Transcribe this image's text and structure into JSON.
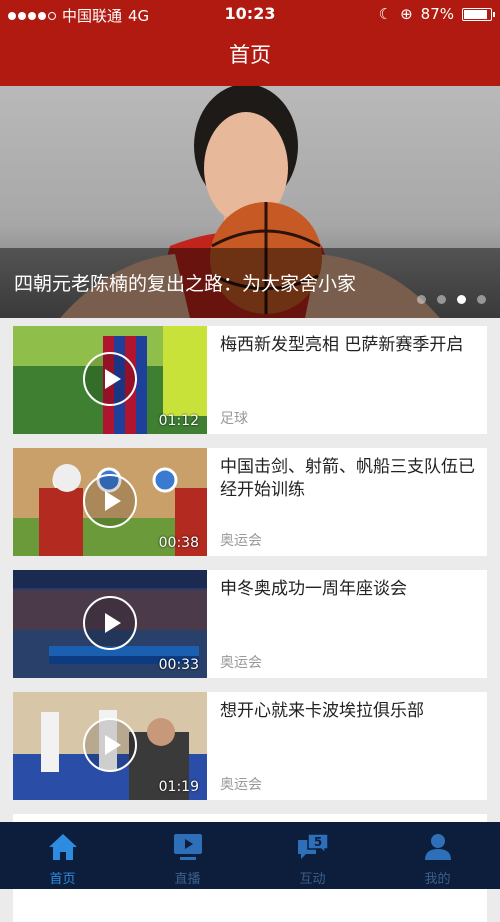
{
  "status_bar": {
    "carrier": "中国联通",
    "network": "4G",
    "time": "10:23",
    "battery": "87%",
    "battery_level": 0.87
  },
  "nav": {
    "title": "首页"
  },
  "banner": {
    "caption": "四朝元老陈楠的复出之路：为大家舍小家",
    "page_count": 4,
    "active_page": 3
  },
  "videos": [
    {
      "title": "梅西新发型亮相 巴萨新赛季开启",
      "category": "足球",
      "duration": "01:12"
    },
    {
      "title": "中国击剑、射箭、帆船三支队伍已经开始训练",
      "category": "奥运会",
      "duration": "00:38"
    },
    {
      "title": "申冬奥成功一周年座谈会",
      "category": "奥运会",
      "duration": "00:33"
    },
    {
      "title": "想开心就来卡波埃拉俱乐部",
      "category": "奥运会",
      "duration": "01:19"
    }
  ],
  "tabs": [
    {
      "label": "首页",
      "icon": "home-icon",
      "active": true
    },
    {
      "label": "直播",
      "icon": "live-tv-icon",
      "active": false
    },
    {
      "label": "互动",
      "icon": "chat-bubbles-icon",
      "badge": "5",
      "active": false
    },
    {
      "label": "我的",
      "icon": "user-icon",
      "active": false
    }
  ],
  "colors": {
    "brand_red": "#b01a10",
    "tabbar_bg": "#0c1e3c",
    "tab_active": "#2d8ce0",
    "tab_inactive": "#3b5f8c"
  }
}
